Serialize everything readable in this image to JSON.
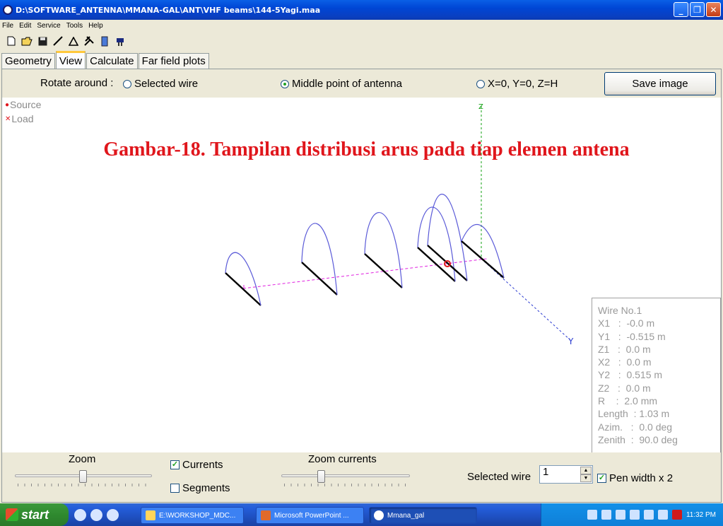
{
  "window": {
    "title": "D:\\SOFTWARE_ANTENNA\\MMANA-GAL\\ANT\\VHF beams\\144-5Yagi.maa"
  },
  "menu": [
    "File",
    "Edit",
    "Service",
    "Tools",
    "Help"
  ],
  "toolbar_icons": [
    "new-file-icon",
    "open-folder-icon",
    "save-disk-icon",
    "line-icon",
    "triangle-icon",
    "tools-icon",
    "book-icon",
    "plug-icon"
  ],
  "tabs": [
    {
      "label": "Geometry",
      "active": false
    },
    {
      "label": "View",
      "active": true
    },
    {
      "label": "Calculate",
      "active": false
    },
    {
      "label": "Far field plots",
      "active": false
    }
  ],
  "rotate": {
    "label": "Rotate around :",
    "options": [
      {
        "label": "Selected wire",
        "checked": false
      },
      {
        "label": "Middle point of antenna",
        "checked": true
      },
      {
        "label": "X=0, Y=0, Z=H",
        "checked": false
      }
    ]
  },
  "save_image": "Save image",
  "legend": {
    "source": "Source",
    "load": "Load"
  },
  "caption": "Gambar-18. Tampilan distribusi arus pada tiap elemen antena",
  "axes": {
    "z": "Z",
    "y": "Y"
  },
  "wire_info": {
    "title": "Wire No.1",
    "lines": [
      "X1   :  -0.0 m",
      "Y1   :  -0.515 m",
      "Z1   :  0.0 m",
      "X2   :  0.0 m",
      "Y2   :  0.515 m",
      "Z2   :  0.0 m",
      "R    :  2.0 mm",
      "Length  : 1.03 m",
      "Azim.   :  0.0 deg",
      "Zenith  :  90.0 deg"
    ]
  },
  "bottom": {
    "zoom_label": "Zoom",
    "zoom_value": 0.5,
    "currents_label": "Currents",
    "currents_checked": true,
    "segments_label": "Segments",
    "segments_checked": false,
    "zoom_currents_label": "Zoom currents",
    "zoom_currents_value": 0.3,
    "selected_wire_label": "Selected wire",
    "selected_wire_value": "1",
    "pen_width_label": "Pen width x 2",
    "pen_width_checked": true
  },
  "taskbar": {
    "start": "start",
    "tasks": [
      {
        "label": "E:\\WORKSHOP_MDC...",
        "active": false
      },
      {
        "label": "Microsoft PowerPoint ...",
        "active": false
      },
      {
        "label": "Mmana_gal",
        "active": true
      }
    ],
    "clock": "11:32 PM"
  },
  "colors": {
    "caption": "#e0161c",
    "boom": "#e020e0",
    "z_axis": "#12a012",
    "y_axis": "#2a3ad0",
    "current_curve": "#5a5ad8",
    "element": "#000000"
  }
}
